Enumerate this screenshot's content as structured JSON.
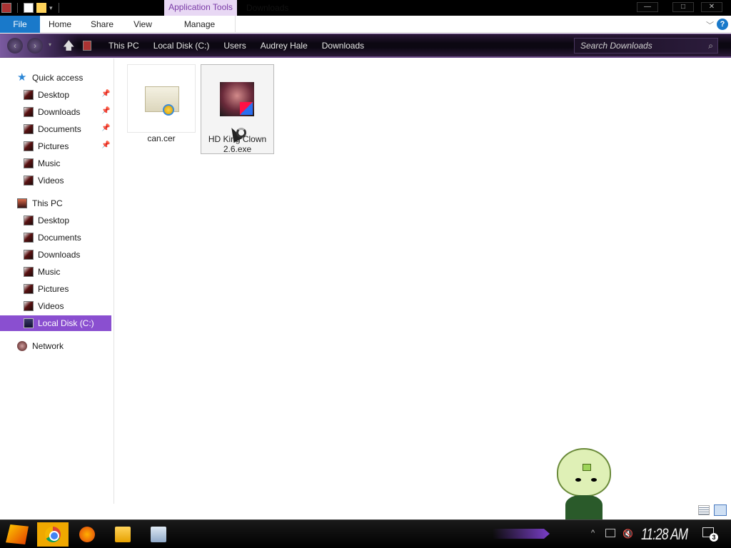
{
  "window": {
    "title": "Downloads",
    "context_tab_label": "Application Tools",
    "controls": {
      "minimize": "—",
      "maximize": "□",
      "close": "✕"
    }
  },
  "ribbon": {
    "tabs": [
      {
        "label": "File"
      },
      {
        "label": "Home"
      },
      {
        "label": "Share"
      },
      {
        "label": "View"
      },
      {
        "label": "Manage"
      }
    ],
    "help": "?"
  },
  "navbar": {
    "back": "‹",
    "forward": "›",
    "up": "🡅",
    "breadcrumb": [
      "This PC",
      "Local Disk (C:)",
      "Users",
      "Audrey Hale",
      "Downloads"
    ],
    "search_placeholder": "Search Downloads"
  },
  "sidebar": {
    "quick_access": {
      "label": "Quick access",
      "items": [
        {
          "label": "Desktop",
          "pinned": true
        },
        {
          "label": "Downloads",
          "pinned": true
        },
        {
          "label": "Documents",
          "pinned": true
        },
        {
          "label": "Pictures",
          "pinned": true
        },
        {
          "label": "Music",
          "pinned": false
        },
        {
          "label": "Videos",
          "pinned": false
        }
      ]
    },
    "this_pc": {
      "label": "This PC",
      "items": [
        {
          "label": "Desktop"
        },
        {
          "label": "Documents"
        },
        {
          "label": "Downloads"
        },
        {
          "label": "Music"
        },
        {
          "label": "Pictures"
        },
        {
          "label": "Videos"
        },
        {
          "label": "Local Disk (C:)",
          "selected": true
        }
      ]
    },
    "network": {
      "label": "Network"
    }
  },
  "files": [
    {
      "name": "can.cer",
      "icon": "certificate-icon",
      "selected": false
    },
    {
      "name_line1": "HD King Clown",
      "name_line2": "2.6.exe",
      "icon": "application-icon",
      "selected": true
    }
  ],
  "taskbar": {
    "apps": [
      {
        "name": "chrome-icon",
        "active": true
      },
      {
        "name": "firefox-icon",
        "active": false
      },
      {
        "name": "file-explorer-icon",
        "active": false
      },
      {
        "name": "image-app-icon",
        "active": false
      }
    ],
    "tray_chevron": "^",
    "clock": "11:28 AM",
    "notification_count": "3"
  },
  "colors": {
    "accent": "#1979ca",
    "selection": "#8a4fd0",
    "context_tab": "#e8d8f4"
  }
}
